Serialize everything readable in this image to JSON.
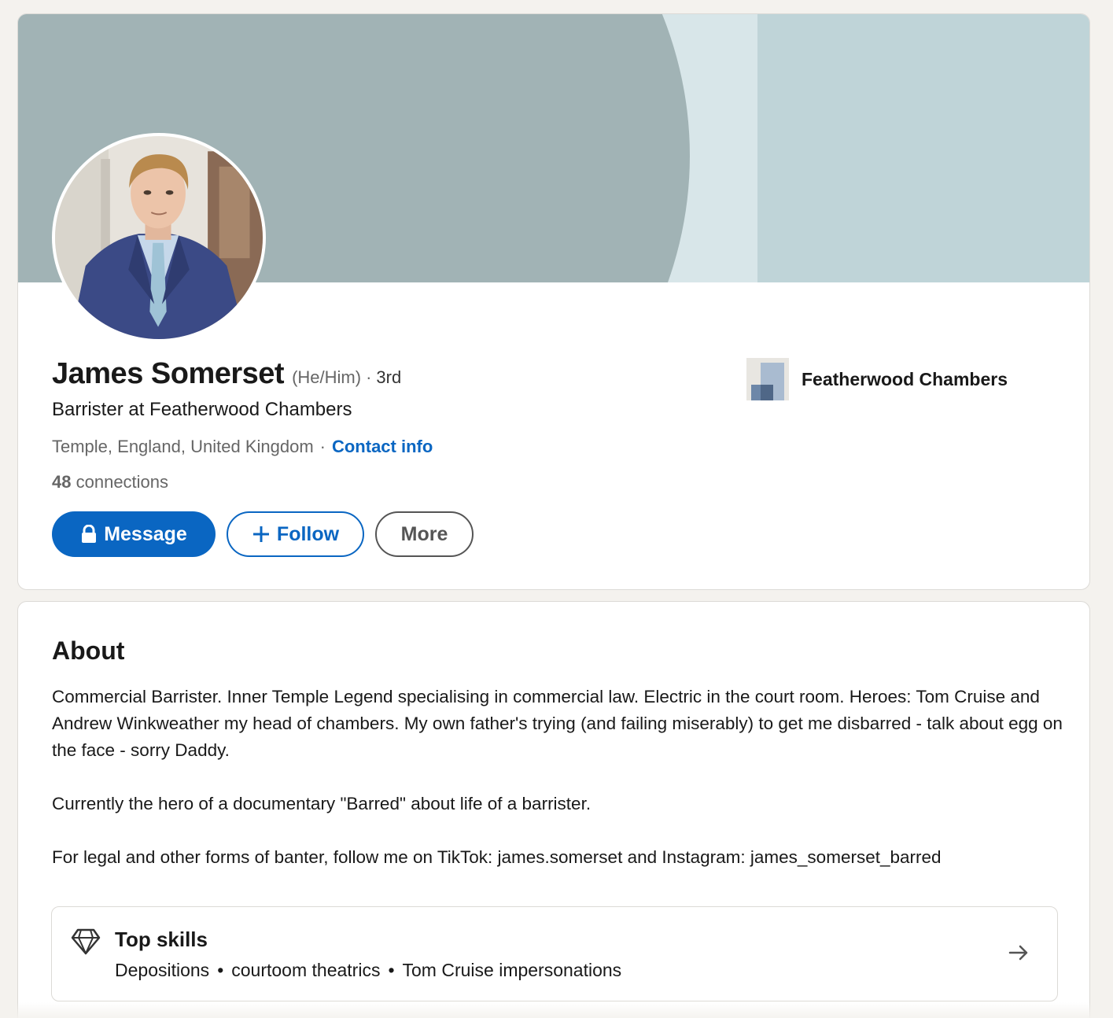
{
  "profile": {
    "name": "James Somerset",
    "pronouns": "(He/Him)",
    "separator": "·",
    "degree": "3rd",
    "headline": "Barrister at Featherwood Chambers",
    "location": "Temple, England, United Kingdom",
    "contact_info_label": "Contact info",
    "connections_count": "48",
    "connections_label": "connections",
    "company_name": "Featherwood Chambers"
  },
  "actions": {
    "message_label": "Message",
    "message_icon": "lock-icon",
    "follow_label": "Follow",
    "follow_icon": "plus-icon",
    "more_label": "More"
  },
  "about": {
    "title": "About",
    "paragraphs": [
      "Commercial Barrister. Inner Temple Legend specialising in commercial law. Electric in the court room. Heroes: Tom Cruise and Andrew Winkweather my head of chambers. My own father's trying (and failing miserably) to get me disbarred - talk about egg on the face - sorry Daddy.",
      "Currently the hero of a documentary \"Barred\" about life of a barrister.",
      "For legal and other forms of banter, follow me on TikTok: james.somerset and Instagram: james_somerset_barred"
    ]
  },
  "top_skills": {
    "title": "Top skills",
    "icon": "diamond-icon",
    "skills": [
      "Depositions",
      "courtoom theatrics",
      "Tom Cruise impersonations"
    ],
    "separator": "•",
    "arrow_icon": "arrow-right-icon"
  },
  "colors": {
    "page_background": "#f4f2ee",
    "brand_blue": "#0a66c2",
    "banner_base": "#bfd4d8",
    "banner_arc": "#a1b3b5",
    "banner_stripe": "#d8e6e9",
    "text_primary": "#191919",
    "text_secondary": "#666666"
  }
}
